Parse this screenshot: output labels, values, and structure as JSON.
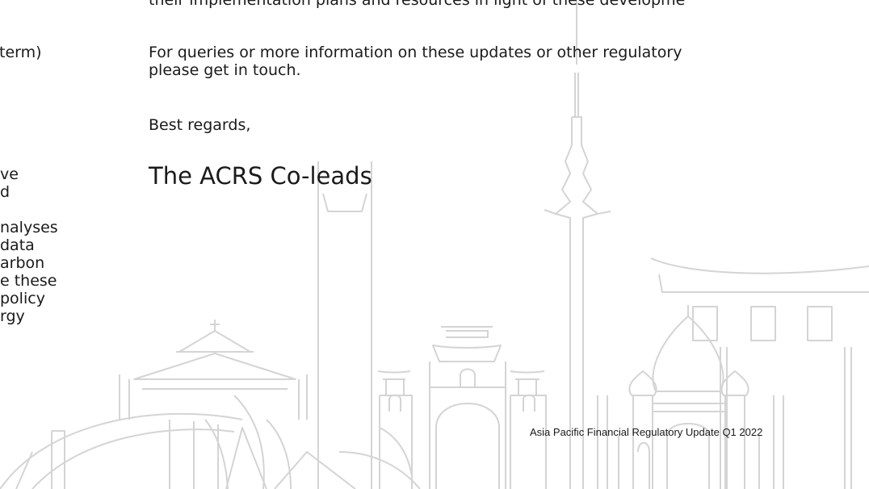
{
  "body": {
    "cut_line": "their implementation plans and resources in light of these developme",
    "query_line_1": "For queries or more information on these updates or other regulatory",
    "query_line_2": "please get in touch.",
    "regards": "Best regards,",
    "signature": "The ACRS Co-leads"
  },
  "left_column": {
    "fragments": [
      "term)",
      "ve",
      "d",
      "nalyses",
      "data",
      "arbon",
      "e these",
      "policy",
      "rgy"
    ]
  },
  "footer": {
    "publication": "Asia Pacific Financial Regulatory Update Q1 2022"
  },
  "colors": {
    "text": "#1a1a1a",
    "skyline_stroke": "#d4d4d4"
  }
}
